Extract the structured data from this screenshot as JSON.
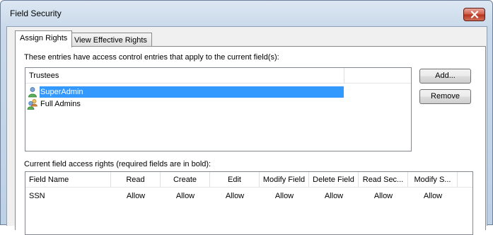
{
  "window": {
    "title": "Field Security"
  },
  "tabs": [
    {
      "label": "Assign Rights",
      "selected": true
    },
    {
      "label": "View Effective Rights",
      "selected": false
    }
  ],
  "trustees_section": {
    "caption": "These entries have access control entries that apply to the current field(s):",
    "column_header": "Trustees",
    "items": [
      {
        "label": "SuperAdmin",
        "icon": "user-icon",
        "selected": true
      },
      {
        "label": "Full Admins",
        "icon": "user-group-icon",
        "selected": false
      }
    ]
  },
  "buttons": {
    "add": "Add...",
    "remove": "Remove"
  },
  "rights_section": {
    "caption": "Current field access rights (required fields are in bold):",
    "columns": [
      "Field Name",
      "Read",
      "Create",
      "Edit",
      "Modify Field",
      "Delete Field",
      "Read Sec...",
      "Modify S..."
    ],
    "rows": [
      [
        "SSN",
        "Allow",
        "Allow",
        "Allow",
        "Allow",
        "Allow",
        "Allow",
        "Allow"
      ]
    ]
  },
  "colors": {
    "selection": "#3399ff",
    "close_button": "#c7432f"
  }
}
